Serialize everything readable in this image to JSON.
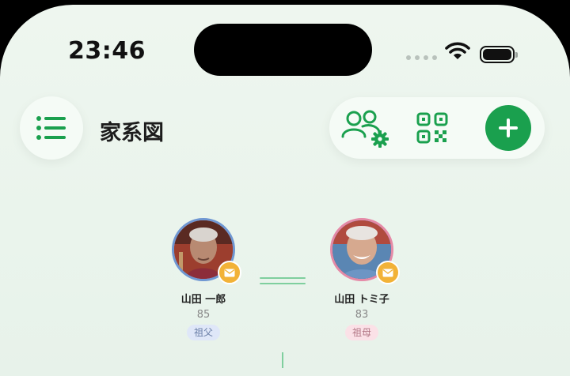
{
  "status_bar": {
    "time": "23:46"
  },
  "header": {
    "title": "家系図",
    "accent_color": "#1aa04e"
  },
  "icons": {
    "menu": "list-icon",
    "people_settings": "people-settings-icon",
    "qr": "qr-code-icon",
    "add": "plus-icon",
    "mail": "mail-icon"
  },
  "family": {
    "members": [
      {
        "name": "山田 一郎",
        "age": "85",
        "relation": "祖父",
        "ring_color": "#6f97d2"
      },
      {
        "name": "山田 トミ子",
        "age": "83",
        "relation": "祖母",
        "ring_color": "#e58aa7"
      }
    ]
  }
}
